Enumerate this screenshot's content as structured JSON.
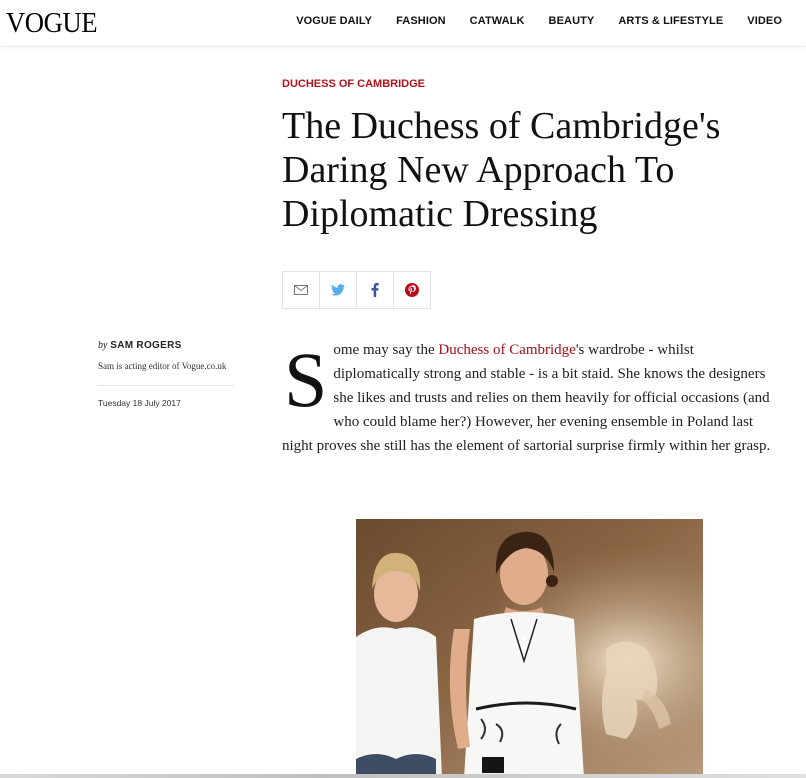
{
  "header": {
    "logo": "VOGUE",
    "nav": [
      "VOGUE DAILY",
      "FASHION",
      "CATWALK",
      "BEAUTY",
      "ARTS & LIFESTYLE",
      "VIDEO"
    ]
  },
  "article": {
    "kicker": "DUCHESS OF CAMBRIDGE",
    "title": "The Duchess of Cambridge's Daring New Approach To Diplomatic Dressing",
    "share": [
      "mail-icon",
      "twitter-icon",
      "facebook-icon",
      "pinterest-icon"
    ],
    "byline": {
      "by": "by",
      "author": "SAM ROGERS",
      "bio": "Sam is acting editor of Vogue.co.uk",
      "date": "Tuesday 18 July 2017"
    },
    "body": {
      "dropcap": "S",
      "before_link": "ome may say the ",
      "link": "Duchess of Cambridge",
      "after_link": "'s wardrobe - whilst diplomatically strong and stable - is a bit staid. She knows the designers she likes and trusts and relies on them heavily for official occasions (and who could blame her?) However, her evening ensemble in Poland last night proves she still has the element of sartorial surprise firmly within her grasp."
    }
  },
  "colors": {
    "accent": "#b3121d",
    "link": "#a50f1b",
    "twitter": "#55acee",
    "facebook": "#3b5998",
    "pinterest": "#bd081c"
  }
}
